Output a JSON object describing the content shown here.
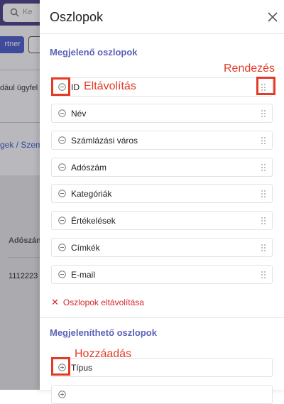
{
  "background": {
    "search_placeholder": "Ke",
    "primary_button_label": "rtner",
    "hint_text": "dául ügyfel",
    "breadcrumb": "gek / Szem",
    "column_header": "Adószán",
    "cell_value": "1112223"
  },
  "panel": {
    "title": "Oszlopok",
    "visible_section_title": "Megjelenő oszlopok",
    "visible_columns": [
      {
        "label": "ID"
      },
      {
        "label": "Név"
      },
      {
        "label": "Számlázási város"
      },
      {
        "label": "Adószám"
      },
      {
        "label": "Kategóriák"
      },
      {
        "label": "Értékelések"
      },
      {
        "label": "Címkék"
      },
      {
        "label": "E-mail"
      }
    ],
    "remove_all_label": "Oszlopok eltávolítása",
    "available_section_title": "Megjeleníthető oszlopok",
    "available_columns": [
      {
        "label": "Típus"
      }
    ]
  },
  "annotations": {
    "remove": "Eltávolítás",
    "sort": "Rendezés",
    "add": "Hozzáadás"
  },
  "colors": {
    "accent": "#5b62b8",
    "danger": "#d8262a",
    "annotation": "#e33b27"
  }
}
